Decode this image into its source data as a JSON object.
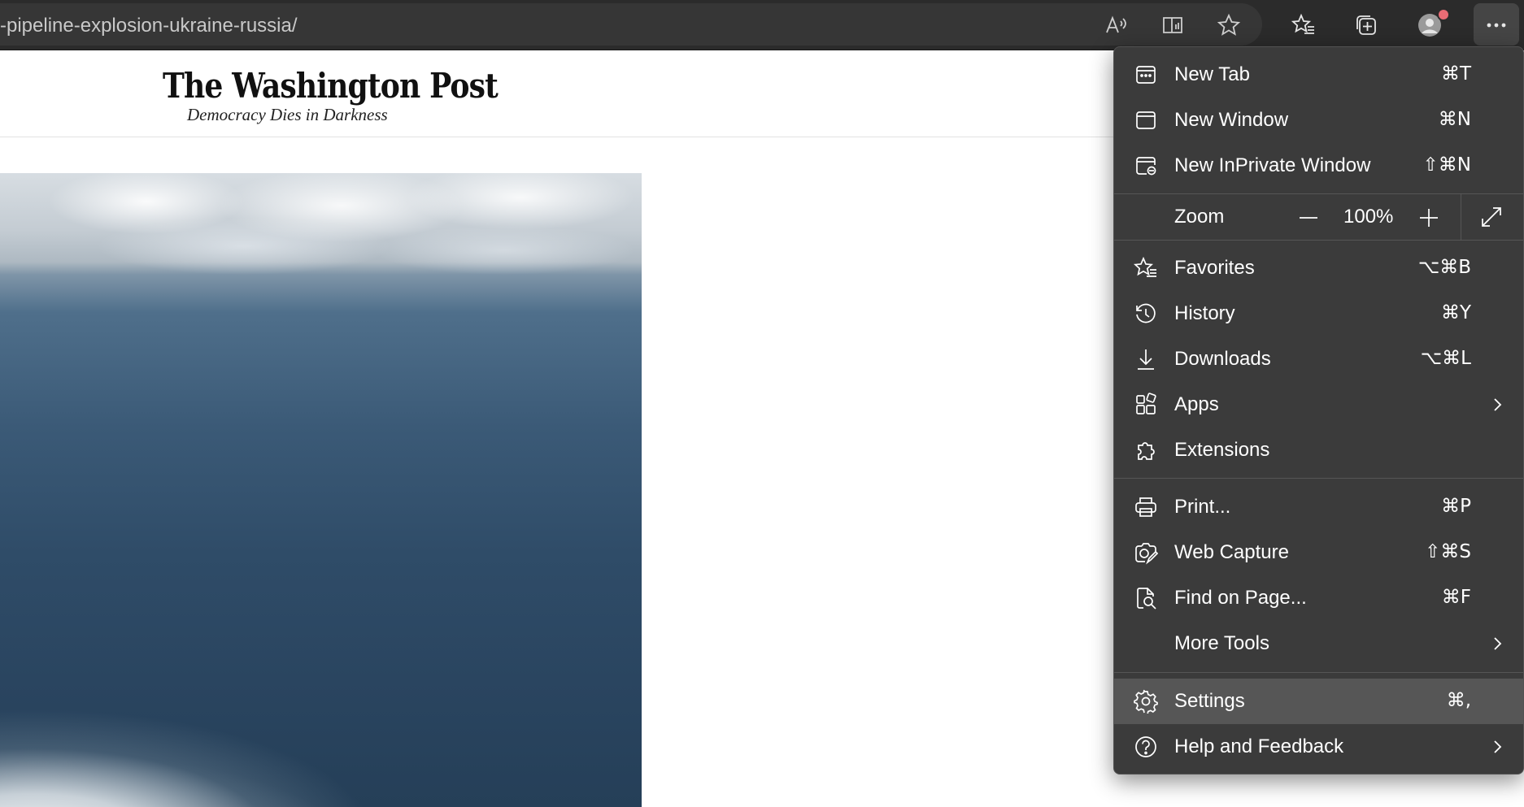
{
  "browser": {
    "url": "-pipeline-explosion-ukraine-russia/"
  },
  "page": {
    "logo": "The Washington Post",
    "tagline": "Democracy Dies in Darkness"
  },
  "menu": {
    "items": [
      {
        "label": "New Tab",
        "shortcut": "⌘T",
        "icon": "new-tab-icon"
      },
      {
        "label": "New Window",
        "shortcut": "⌘N",
        "icon": "new-window-icon"
      },
      {
        "label": "New InPrivate Window",
        "shortcut": "⇧⌘N",
        "icon": "inprivate-window-icon"
      },
      {
        "label": "Favorites",
        "shortcut": "⌥⌘B",
        "icon": "favorites-icon"
      },
      {
        "label": "History",
        "shortcut": "⌘Y",
        "icon": "history-icon"
      },
      {
        "label": "Downloads",
        "shortcut": "⌥⌘L",
        "icon": "downloads-icon"
      },
      {
        "label": "Apps",
        "shortcut": "",
        "icon": "apps-icon"
      },
      {
        "label": "Extensions",
        "shortcut": "",
        "icon": "extensions-icon"
      },
      {
        "label": "Print...",
        "shortcut": "⌘P",
        "icon": "print-icon"
      },
      {
        "label": "Web Capture",
        "shortcut": "⇧⌘S",
        "icon": "web-capture-icon"
      },
      {
        "label": "Find on Page...",
        "shortcut": "⌘F",
        "icon": "find-icon"
      },
      {
        "label": "More Tools",
        "shortcut": "",
        "icon": ""
      },
      {
        "label": "Settings",
        "shortcut": "⌘,",
        "icon": "settings-icon"
      },
      {
        "label": "Help and Feedback",
        "shortcut": "",
        "icon": "help-icon"
      }
    ],
    "zoom": {
      "label": "Zoom",
      "value": "100%"
    }
  },
  "colors": {
    "menu_bg": "#3b3b3b",
    "menu_highlight": "#565656",
    "toolbar_bg": "#2b2b2b",
    "notification_dot": "#e86c75"
  }
}
